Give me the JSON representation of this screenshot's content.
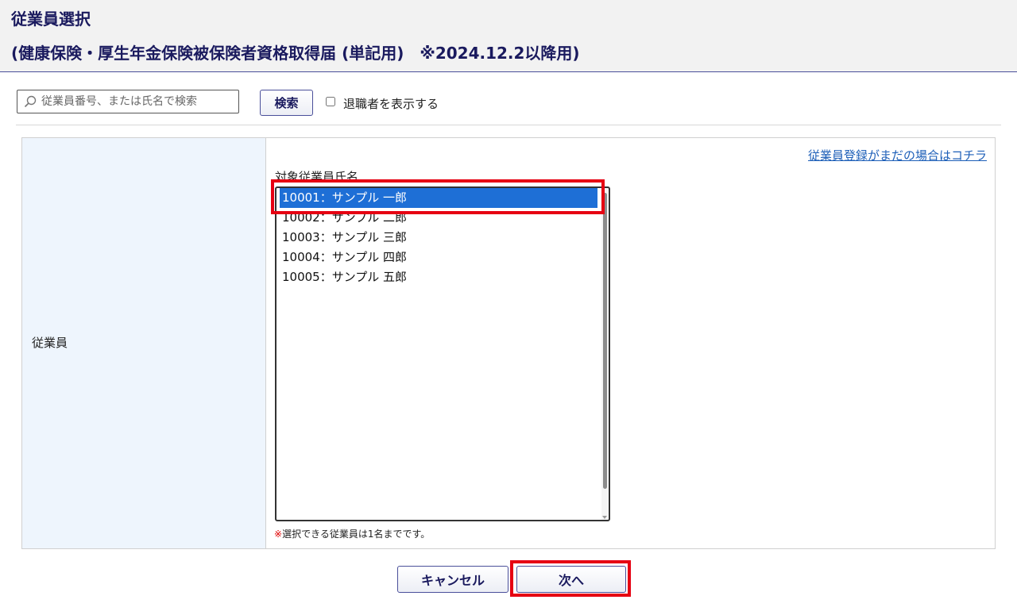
{
  "header": {
    "title": "従業員選択",
    "subtitle": "(健康保険・厚生年金保険被保険者資格取得届 (単記用)　※2024.12.2以降用)"
  },
  "search": {
    "placeholder": "従業員番号、または氏名で検索",
    "value": "",
    "button_label": "検索",
    "show_retired_label": "退職者を表示する",
    "show_retired_checked": false
  },
  "form": {
    "row_label": "従業員",
    "register_link": "従業員登録がまだの場合はコチラ",
    "list_label": "対象従業員氏名",
    "employees": [
      {
        "label": "10001：サンプル 一郎",
        "selected": true
      },
      {
        "label": "10002：サンプル 二郎",
        "selected": false
      },
      {
        "label": "10003：サンプル 三郎",
        "selected": false
      },
      {
        "label": "10004：サンプル 四郎",
        "selected": false
      },
      {
        "label": "10005：サンプル 五郎",
        "selected": false
      }
    ],
    "note_mark": "※",
    "note_text": "選択できる従業員は1名までです。"
  },
  "footer": {
    "cancel_label": "キャンセル",
    "next_label": "次へ"
  },
  "colors": {
    "selection": "#1e6fd6",
    "highlight": "#e60012",
    "label_cell_bg": "#eef5fd",
    "link": "#1d5fb8",
    "title": "#1a1a5e"
  }
}
